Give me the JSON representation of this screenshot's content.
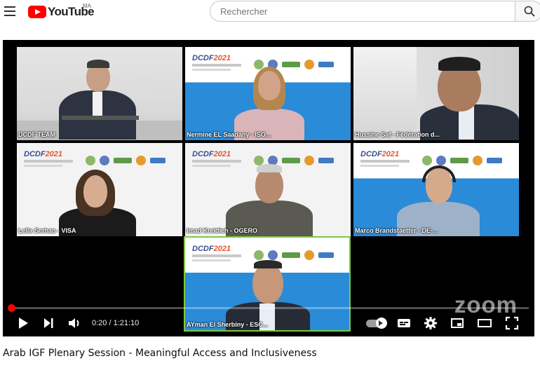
{
  "header": {
    "logo_text": "YouTube",
    "country_code": "MA",
    "search_placeholder": "Rechercher"
  },
  "video": {
    "participants": [
      {
        "label": "DCDF TEAM"
      },
      {
        "label": "Nermine EL Saadany - ISO..."
      },
      {
        "label": "Hussine Saf - Fédération d..."
      },
      {
        "label": "Leila Serhan - VISA"
      },
      {
        "label": "Imad Kreidieh - OGERO"
      },
      {
        "label": "Marco Brandstaetter - DE-..."
      },
      {
        "label": "AYman El Sherbiny - ESC..."
      }
    ],
    "banner_logo": "DCDF",
    "banner_year": "2021",
    "watermark": "zoom",
    "active_speaker": "AYman El Sherbiny - ESC..."
  },
  "controls": {
    "time_current": "0:20",
    "time_separator": " / ",
    "time_total": "1:21:10",
    "progress_fraction": 0.0041
  },
  "title": "Arab IGF Plenary Session - Meaningful Access and Inclusiveness",
  "colors": {
    "accent": "#ff0000",
    "active_border": "#7ac943",
    "dcdf_blue": "#2a8bd8"
  }
}
